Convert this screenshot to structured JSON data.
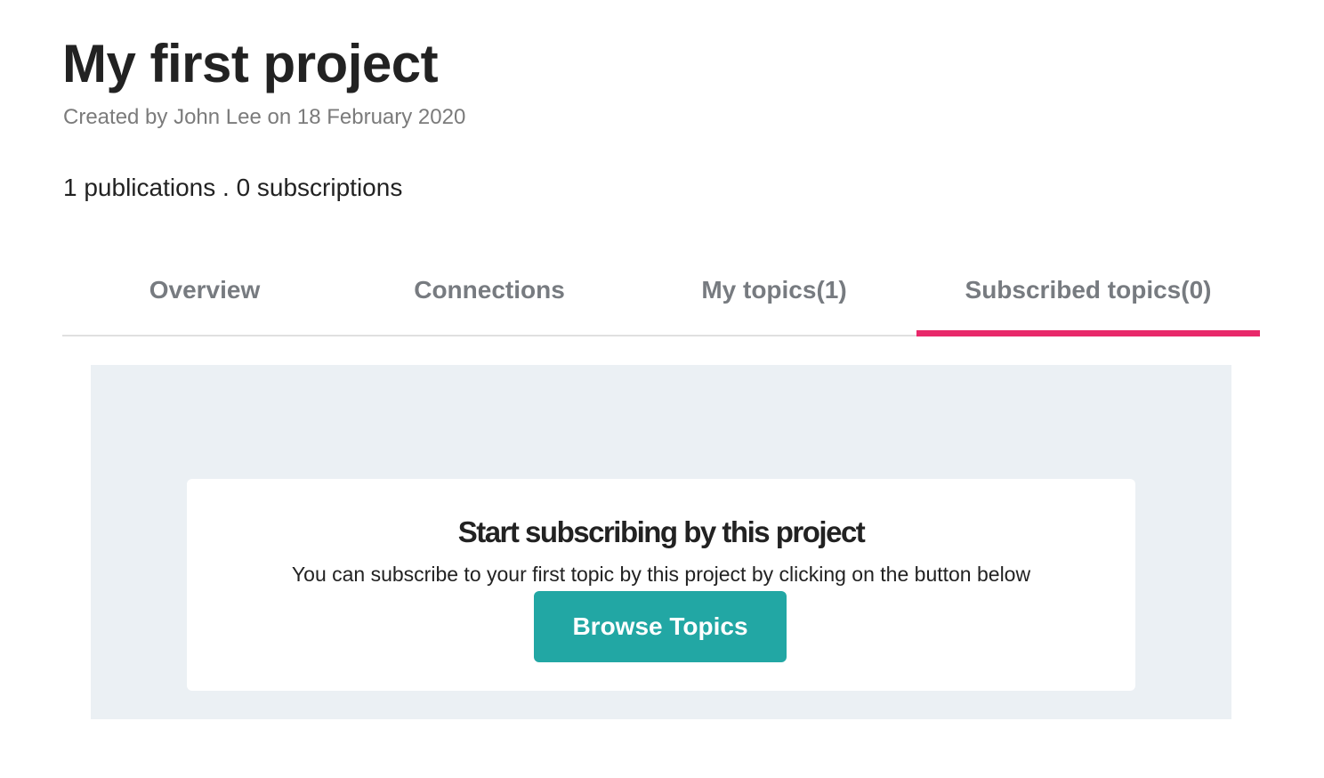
{
  "project": {
    "title": "My first project",
    "created_info": "Created by John Lee on 18 February 2020",
    "stats": "1 publications . 0 subscriptions"
  },
  "tabs": [
    {
      "label": "Overview",
      "active": false
    },
    {
      "label": "Connections",
      "active": false
    },
    {
      "label": "My topics(1)",
      "active": false
    },
    {
      "label": "Subscribed topics(0)",
      "active": true
    }
  ],
  "empty_state": {
    "heading": "Start subscribing by this project",
    "description": "You can subscribe to your first topic by this project by clicking on the button below",
    "button_label": "Browse Topics"
  },
  "colors": {
    "accent_tab_underline": "#e8286a",
    "primary_button": "#22a7a4",
    "panel_background": "#ebf0f4"
  }
}
